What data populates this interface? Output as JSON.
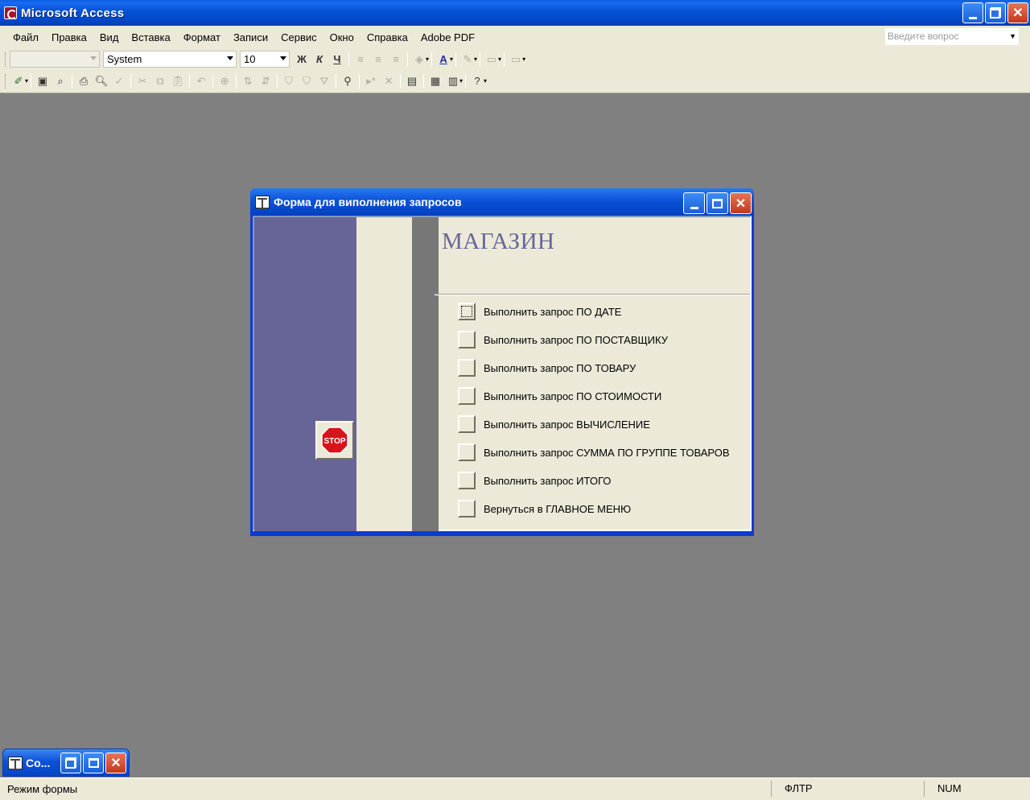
{
  "app": {
    "title": "Microsoft Access"
  },
  "menu": {
    "items": [
      "Файл",
      "Правка",
      "Вид",
      "Вставка",
      "Формат",
      "Записи",
      "Сервис",
      "Окно",
      "Справка",
      "Adobe PDF"
    ],
    "ask_placeholder": "Введите вопрос"
  },
  "format_toolbar": {
    "object_combo": "",
    "font_name": "System",
    "font_size": "10",
    "bold": "Ж",
    "italic": "К",
    "underline": "Ч"
  },
  "form": {
    "window_title": "Форма для виполнения запросов",
    "heading": "МАГАЗИН",
    "stop_label": "STOP",
    "buttons": [
      {
        "label": "Выполнить запрос ПО ДАТЕ"
      },
      {
        "label": "Выполнить запрос ПО ПОСТАВЩИКУ"
      },
      {
        "label": "Выполнить запрос ПО ТОВАРУ"
      },
      {
        "label": "Выполнить запрос ПО СТОИМОСТИ"
      },
      {
        "label": "Выполнить запрос ВЫЧИСЛЕНИЕ"
      },
      {
        "label": "Выполнить запрос СУММА ПО ГРУППЕ ТОВАРОВ"
      },
      {
        "label": "Выполнить запрос ИТОГО"
      },
      {
        "label": "Вернуться в ГЛАВНОЕ МЕНЮ"
      }
    ]
  },
  "minimized_window": {
    "title": "Со..."
  },
  "status": {
    "mode": "Режим формы",
    "filter": "ФЛТР",
    "numlock": "NUM"
  },
  "colors": {
    "title_blue": "#0454d8",
    "form_purple": "#676597",
    "workspace": "#808080",
    "chrome": "#ece9d8"
  }
}
